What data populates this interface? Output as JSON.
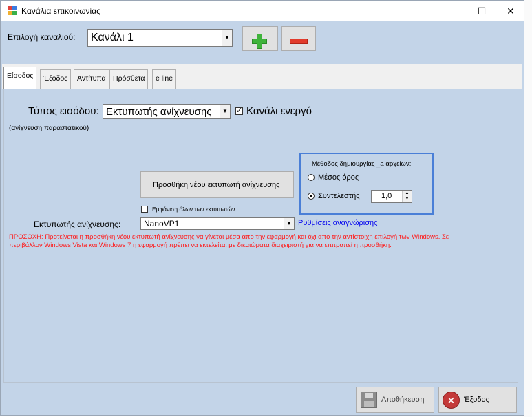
{
  "window": {
    "title": "Κανάλια επικοινωνίας",
    "minimize": "—",
    "maximize": "☐",
    "close": "✕"
  },
  "channel": {
    "label": "Επιλογή καναλιού:",
    "value": "Κανάλι 1"
  },
  "tabs": [
    {
      "label": "Είσοδος"
    },
    {
      "label": "Έξοδος"
    },
    {
      "label": "Αντίτυπα"
    },
    {
      "label": "Πρόσθετα"
    },
    {
      "label": "e line"
    }
  ],
  "input": {
    "type_label": "Τύπος εισόδου:",
    "type_value": "Εκτυπωτής ανίχνευσης",
    "channel_active_label": "Κανάλι ενεργό",
    "subtitle": "(ανίχνευση παραστατικού)",
    "add_printer_label": "Προσθήκη νέου εκτυπωτή ανίχνευσης",
    "show_all_label": "Εμφάνιση όλων των εκτυπωτών",
    "printer_label": "Εκτυπωτής ανίχνευσης:",
    "printer_value": "NanoVP1",
    "settings_link": "Ρυθμίσεις αναγνώρισης"
  },
  "method": {
    "title": "Μέθοδος δημιουργίας _a αρχείων:",
    "average_label": "Μέσος όρος",
    "coefficient_label": "Συντελεστής",
    "coefficient_value": "1,0"
  },
  "warning": "ΠΡΟΣΟΧΗ: Προτείνεται η προσθήκη νέου εκτυπωτή ανίχνευσης να γίνεται μέσα απο την εφαρμογή και όχι απο την αντίστοιχη επιλογή των Windows. Σε περιβάλλον Windows Vista και Windows 7 η εφαρμογή πρέπει να εκτελείται με δικαιώματα διαχειριστή για να επιτραπεί η προσθήκη.",
  "footer": {
    "save_label": "Αποθήκευση",
    "exit_label": "Έξοδος"
  },
  "colors": {
    "background": "#c3d4e8",
    "accent": "#4a7fd7",
    "warning": "#ff1a1a",
    "add": "#3fb33b",
    "remove": "#e23b2b"
  }
}
